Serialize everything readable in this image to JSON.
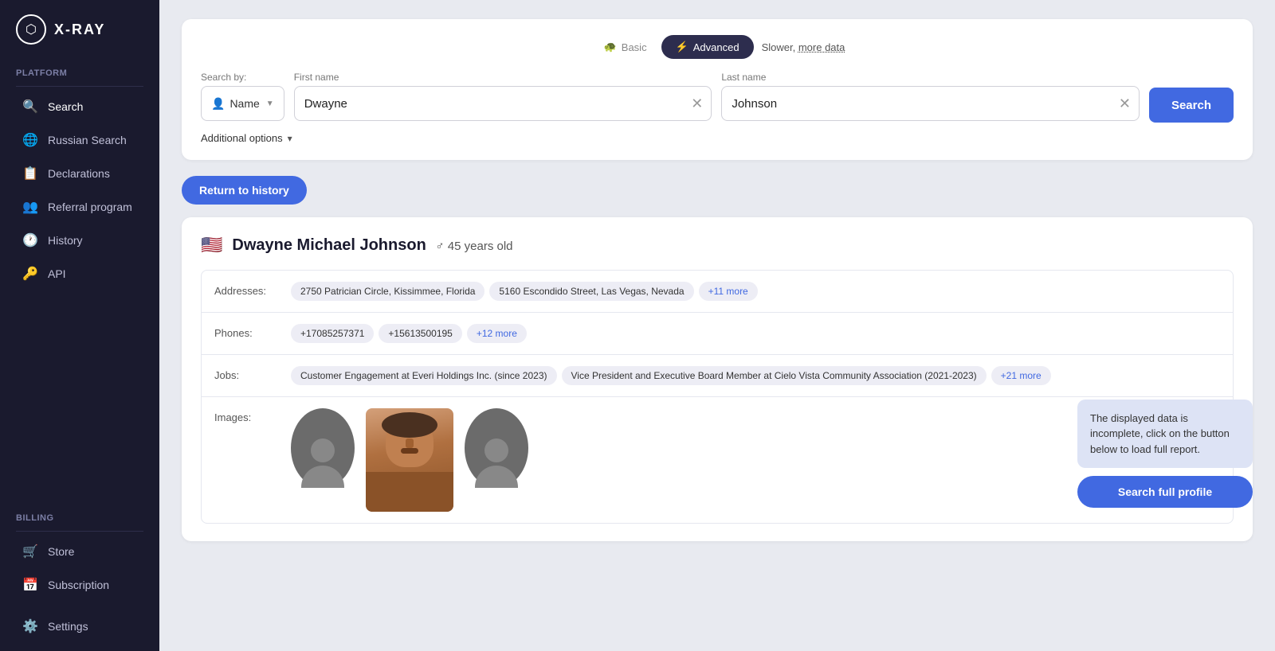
{
  "logo": {
    "icon": "⬡",
    "text": "X-RAY"
  },
  "sidebar": {
    "platform_label": "Platform",
    "billing_label": "Billing",
    "items": [
      {
        "id": "search",
        "label": "Search",
        "icon": "🔍",
        "active": true
      },
      {
        "id": "russian-search",
        "label": "Russian Search",
        "icon": "🌐"
      },
      {
        "id": "declarations",
        "label": "Declarations",
        "icon": "📋"
      },
      {
        "id": "referral",
        "label": "Referral program",
        "icon": "👥"
      },
      {
        "id": "history",
        "label": "History",
        "icon": "🕐"
      },
      {
        "id": "api",
        "label": "API",
        "icon": "🔑"
      }
    ],
    "billing_items": [
      {
        "id": "store",
        "label": "Store",
        "icon": "🛒"
      },
      {
        "id": "subscription",
        "label": "Subscription",
        "icon": "📅"
      }
    ],
    "bottom_items": [
      {
        "id": "settings",
        "label": "Settings",
        "icon": "⚙️"
      }
    ]
  },
  "search": {
    "mode_basic": "Basic",
    "mode_advanced": "Advanced",
    "slower_text": "Slower, ",
    "slower_link": "more data",
    "search_by_label": "Search by:",
    "search_by_value": "Name",
    "first_name_label": "First name",
    "first_name_value": "Dwayne",
    "last_name_label": "Last name",
    "last_name_value": "Johnson",
    "search_button": "Search",
    "additional_options": "Additional options"
  },
  "results": {
    "return_btn": "Return to history",
    "flag": "🇺🇸",
    "name": "Dwayne Michael Johnson",
    "gender_icon": "♂",
    "age": "45 years old",
    "addresses_label": "Addresses:",
    "addresses": [
      "2750 Patrician Circle, Kissimmee, Florida",
      "5160 Escondido Street, Las Vegas, Nevada",
      "+11 more"
    ],
    "phones_label": "Phones:",
    "phones": [
      "+17085257371",
      "+15613500195",
      "+12 more"
    ],
    "jobs_label": "Jobs:",
    "jobs": [
      "Customer Engagement at Everi Holdings Inc. (since 2023)",
      "Vice President and Executive Board Member at Cielo Vista Community Association (2021-2023)",
      "+21 more"
    ],
    "images_label": "Images:"
  },
  "tooltip": {
    "text": "The displayed data is incomplete, click on the button below to load full report.",
    "button": "Search full profile"
  }
}
